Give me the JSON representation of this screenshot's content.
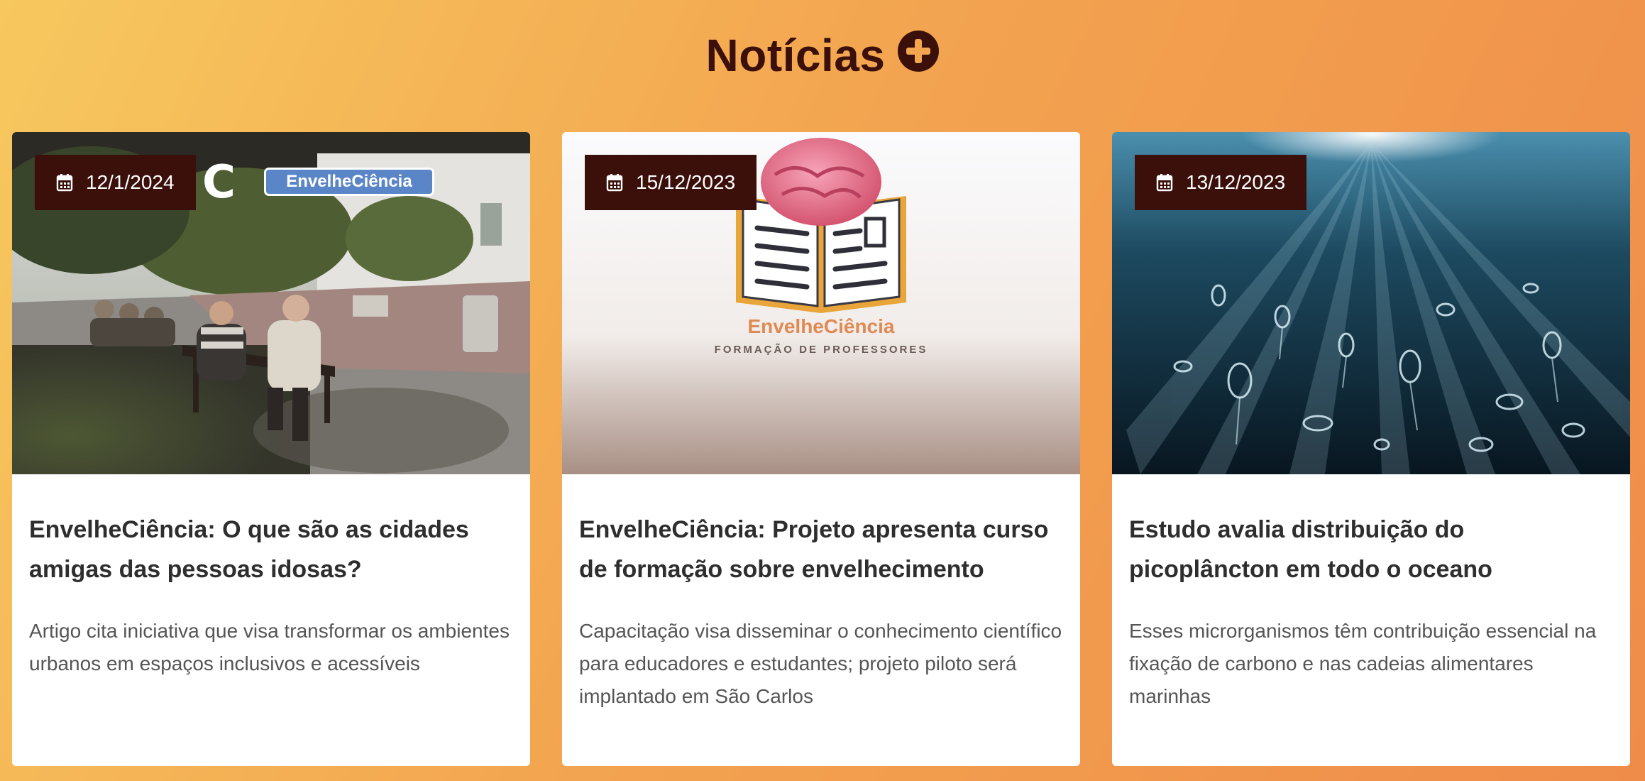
{
  "section": {
    "title": "Notícias",
    "add_icon": "plus-circle-icon"
  },
  "colors": {
    "background_start": "#f7c85e",
    "background_end": "#ef8c4a",
    "dark_accent": "#3b0f0a",
    "card_background": "#ffffff"
  },
  "cards": [
    {
      "date": "12/1/2024",
      "image_overlay_text": "EnvelheCiência",
      "image_overlay_letter": "C",
      "title": "EnvelheCiência: O que são as cidades amigas das pessoas idosas?",
      "excerpt": "Artigo cita iniciativa que visa transformar os ambientes urbanos em espaços inclusivos e acessíveis"
    },
    {
      "date": "15/12/2023",
      "image_brand_name": "EnvelheCiência",
      "image_brand_subtitle": "FORMAÇÃO DE PROFESSORES",
      "title": "EnvelheCiência: Projeto apresenta curso de formação sobre envelhecimento",
      "excerpt": "Capacitação visa disseminar o conhecimento científico para educadores e estudantes; projeto piloto será implantado em São Carlos"
    },
    {
      "date": "13/12/2023",
      "title": "Estudo avalia distribuição do picoplâncton em todo o oceano",
      "excerpt": "Esses microrganismos têm contribuição essencial na fixação de carbono e nas cadeias alimentares marinhas"
    }
  ],
  "icons": {
    "date": "calendar-icon"
  }
}
